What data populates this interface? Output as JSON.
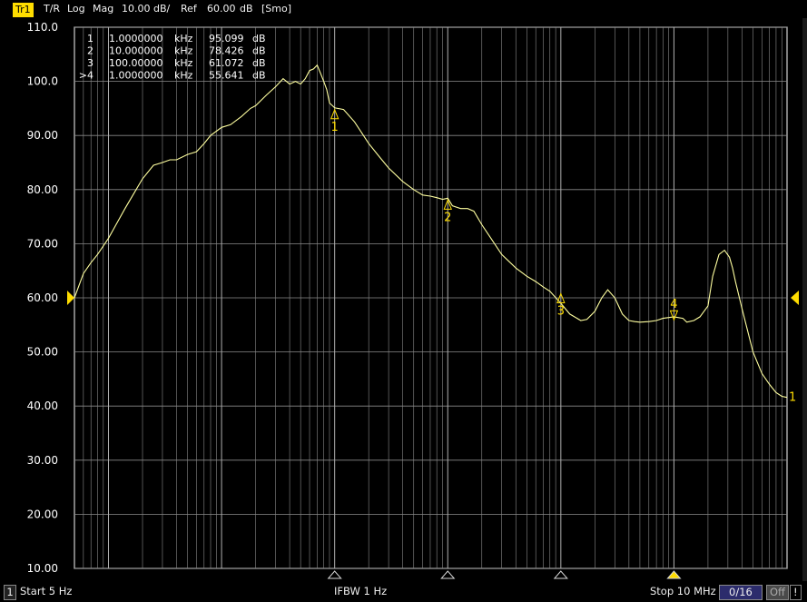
{
  "header": {
    "trace": "Tr1",
    "measure": "T/R",
    "format": "Log",
    "mag": "Mag",
    "scale": "10.00 dB/",
    "ref_label": "Ref",
    "ref_value": "60.00",
    "ref_unit": "dB",
    "smoothing": "[Smo]"
  },
  "markers_table": [
    {
      "id": "1",
      "freq": "1.0000000",
      "unit": "kHz",
      "value": "95.099",
      "vunit": "dB"
    },
    {
      "id": "2",
      "freq": "10.000000",
      "unit": "kHz",
      "value": "78.426",
      "vunit": "dB"
    },
    {
      "id": "3",
      "freq": "100.00000",
      "unit": "kHz",
      "value": "61.072",
      "vunit": "dB"
    },
    {
      "id": ">4",
      "freq": "1.0000000",
      "unit": "kHz",
      "value": "55.641",
      "vunit": "dB"
    }
  ],
  "colors": {
    "trace": "#ffffa0",
    "marker": "#ffdd00",
    "grid": "#8a8a8a",
    "background": "#000000"
  },
  "chart_data": {
    "type": "line",
    "x_scale": "log",
    "xlim": [
      5,
      10000000
    ],
    "x_unit": "Hz",
    "ylim": [
      10,
      110
    ],
    "y_ticks": [
      "110.0",
      "100.0",
      "90.00",
      "80.00",
      "70.00",
      "60.00",
      "50.00",
      "40.00",
      "30.00",
      "20.00",
      "10.00"
    ],
    "y_values": [
      110,
      100,
      90,
      80,
      70,
      60,
      50,
      40,
      30,
      20,
      10
    ],
    "grid": true,
    "reference_level": 60,
    "series": [
      {
        "x": [
          5,
          6,
          7,
          8,
          10,
          12,
          14,
          17,
          20,
          25,
          30,
          35,
          40,
          50,
          60,
          70,
          80,
          100,
          120,
          150,
          180,
          200,
          250,
          300,
          350,
          400,
          450,
          500,
          550,
          600,
          650,
          700,
          750,
          800,
          850,
          900,
          1000,
          1200,
          1500,
          2000,
          2500,
          3000,
          4000,
          5000,
          6000,
          7000,
          8000,
          9000,
          10000,
          11000,
          13000,
          15000,
          17000,
          20000,
          25000,
          30000,
          40000,
          50000,
          60000,
          70000,
          80000,
          100000,
          120000,
          150000,
          170000,
          200000,
          230000,
          260000,
          300000,
          350000,
          400000,
          450000,
          500000,
          600000,
          700000,
          800000,
          1000000,
          1200000,
          1300000,
          1500000,
          1700000,
          2000000,
          2200000,
          2500000,
          2800000,
          3100000,
          3300000,
          3500000,
          4000000,
          5000000,
          6000000,
          7000000,
          8000000,
          9000000,
          10000000
        ],
        "y": [
          60.0,
          64.5,
          66.5,
          68.0,
          71.0,
          74.0,
          76.5,
          79.5,
          82.0,
          84.5,
          85.0,
          85.5,
          85.5,
          86.5,
          87.0,
          88.5,
          90.0,
          91.5,
          92.0,
          93.5,
          95.0,
          95.5,
          97.5,
          99.0,
          100.5,
          99.5,
          100.0,
          99.5,
          100.5,
          102.0,
          102.3,
          103.0,
          101.5,
          100.0,
          98.5,
          96.0,
          95.1,
          94.8,
          92.5,
          88.5,
          86.0,
          84.0,
          81.5,
          80.0,
          79.0,
          78.8,
          78.5,
          78.2,
          78.4,
          77.0,
          76.5,
          76.5,
          76.0,
          73.5,
          70.5,
          68.0,
          65.5,
          64.0,
          63.0,
          62.0,
          61.2,
          59.0,
          57.0,
          55.8,
          56.0,
          57.5,
          60.0,
          61.5,
          60.0,
          57.0,
          55.8,
          55.6,
          55.5,
          55.6,
          55.8,
          56.2,
          56.5,
          56.2,
          55.5,
          55.8,
          56.5,
          58.5,
          64.0,
          68.0,
          68.8,
          67.5,
          65.5,
          63.0,
          58.0,
          50.0,
          46.0,
          44.0,
          42.5,
          41.8,
          41.6
        ]
      }
    ],
    "markers": [
      {
        "label": "1",
        "x": 1000,
        "y": 95.1,
        "dir": "up"
      },
      {
        "label": "2",
        "x": 10000,
        "y": 78.4,
        "dir": "up"
      },
      {
        "label": "3",
        "x": 100000,
        "y": 61.1,
        "dir": "up"
      },
      {
        "label": "4",
        "x": 1000000,
        "y": 55.6,
        "dir": "down"
      }
    ],
    "trace_end_label": "1"
  },
  "status": {
    "channel": "1",
    "start": "Start 5 Hz",
    "ifbw": "IFBW  1  Hz",
    "stop": "Stop 10 MHz",
    "counter": "0/16",
    "off": "Off",
    "excl": "!"
  }
}
